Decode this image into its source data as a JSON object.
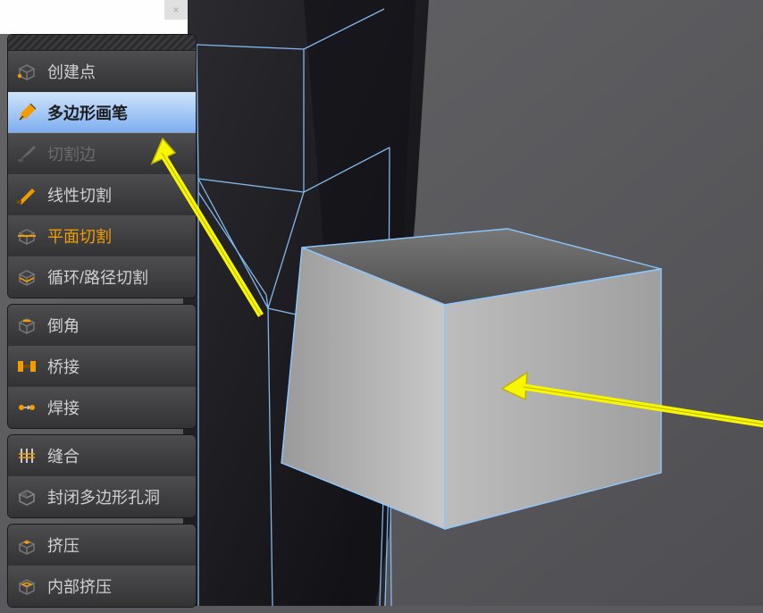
{
  "header": {
    "close_label": "×"
  },
  "tools": {
    "group1": {
      "create_point": "创建点",
      "poly_pen": "多边形画笔",
      "cut_edge": "切割边",
      "line_cut": "线性切割",
      "plane_cut": "平面切割",
      "loop_path_cut": "循环/路径切割"
    },
    "group2": {
      "bevel": "倒角",
      "bridge": "桥接",
      "weld": "焊接"
    },
    "group3": {
      "stitch": "缝合",
      "close_poly_hole": "封闭多边形孔洞"
    },
    "group4": {
      "extrude": "挤压",
      "inner_extrude": "内部挤压"
    }
  },
  "colors": {
    "accent_orange": "#f19d00",
    "wire_blue": "#8CC7FF",
    "selected_blue": "#7eaef0"
  }
}
